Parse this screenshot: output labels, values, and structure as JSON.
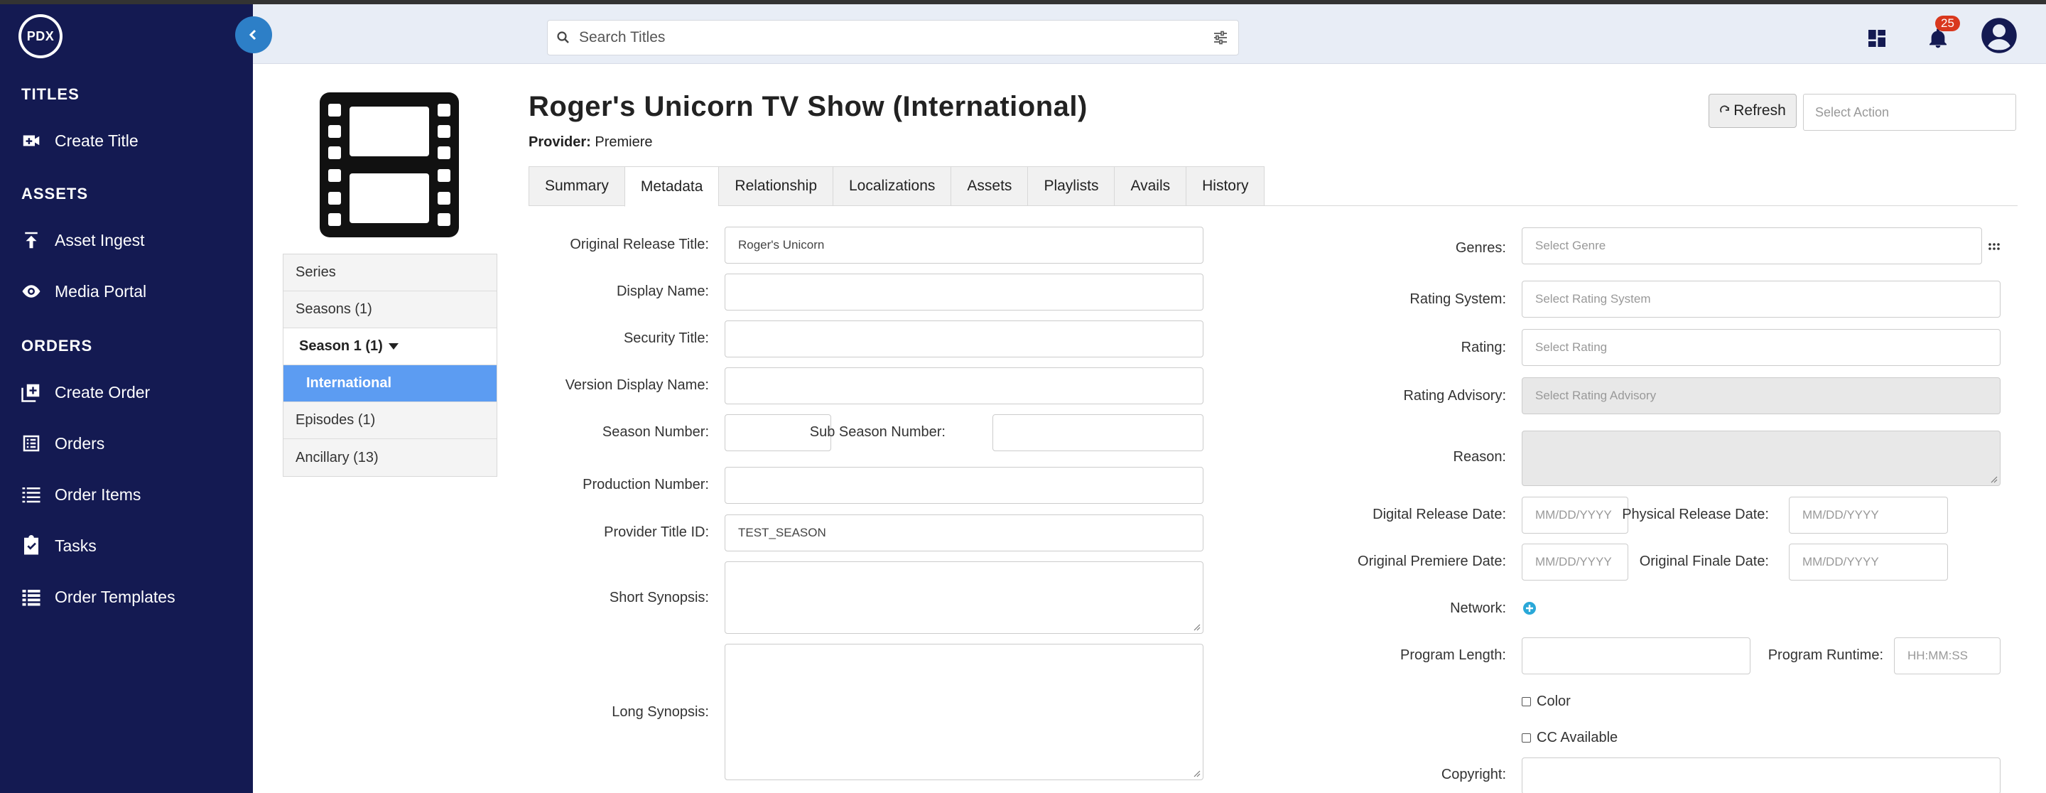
{
  "app": {
    "logo_text": "PDX"
  },
  "sidebar": {
    "sections": [
      {
        "title": "TITLES",
        "items": [
          {
            "label": "Create Title",
            "icon": "add-video-icon"
          }
        ]
      },
      {
        "title": "ASSETS",
        "items": [
          {
            "label": "Asset Ingest",
            "icon": "upload-icon"
          },
          {
            "label": "Media Portal",
            "icon": "eye-icon"
          }
        ]
      },
      {
        "title": "ORDERS",
        "items": [
          {
            "label": "Create Order",
            "icon": "add-box-icon"
          },
          {
            "label": "Orders",
            "icon": "list-alt-icon"
          },
          {
            "label": "Order Items",
            "icon": "list-icon"
          },
          {
            "label": "Tasks",
            "icon": "assignment-check-icon"
          },
          {
            "label": "Order Templates",
            "icon": "table-list-icon"
          }
        ]
      }
    ]
  },
  "header": {
    "search_placeholder": "Search Titles",
    "notification_count": "25"
  },
  "title": {
    "name": "Roger's Unicorn TV Show (International)",
    "provider_label": "Provider:",
    "provider_value": "Premiere",
    "refresh_label": "Refresh",
    "action_placeholder": "Select Action"
  },
  "nav": {
    "series": "Series",
    "seasons": "Seasons (1)",
    "season1": "Season 1 (1)",
    "international": "International",
    "episodes": "Episodes (1)",
    "ancillary": "Ancillary (13)"
  },
  "tabs": [
    "Summary",
    "Metadata",
    "Relationship",
    "Localizations",
    "Assets",
    "Playlists",
    "Avails",
    "History"
  ],
  "active_tab": "Metadata",
  "form_left": {
    "original_release_title_label": "Original Release Title:",
    "original_release_title_value": "Roger's Unicorn",
    "display_name_label": "Display Name:",
    "security_title_label": "Security Title:",
    "version_display_name_label": "Version Display Name:",
    "season_number_label": "Season Number:",
    "sub_season_number_label": "Sub Season Number:",
    "production_number_label": "Production Number:",
    "provider_title_id_label": "Provider Title ID:",
    "provider_title_id_value": "TEST_SEASON",
    "short_synopsis_label": "Short Synopsis:",
    "long_synopsis_label": "Long Synopsis:"
  },
  "form_right": {
    "genres_label": "Genres:",
    "genres_placeholder": "Select Genre",
    "rating_system_label": "Rating System:",
    "rating_system_placeholder": "Select Rating System",
    "rating_label": "Rating:",
    "rating_placeholder": "Select Rating",
    "rating_advisory_label": "Rating Advisory:",
    "rating_advisory_placeholder": "Select Rating Advisory",
    "reason_label": "Reason:",
    "digital_release_date_label": "Digital Release Date:",
    "physical_release_date_label": "Physical Release Date:",
    "original_premiere_date_label": "Original Premiere Date:",
    "original_finale_date_label": "Original Finale Date:",
    "date_placeholder": "MM/DD/YYYY",
    "network_label": "Network:",
    "program_length_label": "Program Length:",
    "program_runtime_label": "Program Runtime:",
    "runtime_placeholder": "HH:MM:SS",
    "color_label": "Color",
    "cc_available_label": "CC Available",
    "copyright_label": "Copyright:"
  },
  "colors": {
    "sidebar_bg": "#141a52",
    "accent": "#2d7fc7",
    "selected": "#5c9cf2",
    "badge": "#d9381e"
  }
}
